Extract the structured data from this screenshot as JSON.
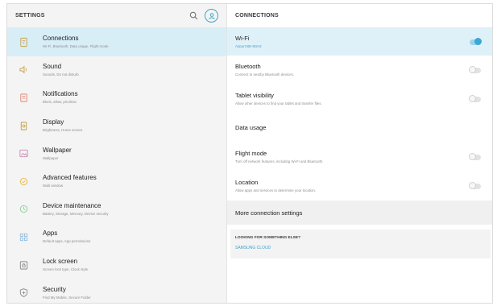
{
  "left_header": {
    "title": "SETTINGS"
  },
  "menu": [
    {
      "title": "Connections",
      "subtitle": "Wi-Fi, Bluetooth, Data usage, Flight mode",
      "icon": "connections-icon",
      "active": true
    },
    {
      "title": "Sound",
      "subtitle": "Sounds, Do not disturb",
      "icon": "speaker-icon"
    },
    {
      "title": "Notifications",
      "subtitle": "Block, allow, prioritise",
      "icon": "notifications-icon"
    },
    {
      "title": "Display",
      "subtitle": "Brightness, Home screen",
      "icon": "display-icon"
    },
    {
      "title": "Wallpaper",
      "subtitle": "Wallpaper",
      "icon": "wallpaper-icon"
    },
    {
      "title": "Advanced features",
      "subtitle": "Multi window",
      "icon": "advanced-features-icon"
    },
    {
      "title": "Device maintenance",
      "subtitle": "Battery, Storage, Memory, Device security",
      "icon": "device-maintenance-icon"
    },
    {
      "title": "Apps",
      "subtitle": "Default apps, App permissions",
      "icon": "apps-icon"
    },
    {
      "title": "Lock screen",
      "subtitle": "Screen lock type, Clock style",
      "icon": "lock-icon"
    },
    {
      "title": "Security",
      "subtitle": "Find My Mobile, Secure Folder",
      "icon": "security-shield-icon"
    }
  ],
  "right_header": {
    "title": "CONNECTIONS"
  },
  "connections": {
    "wifi": {
      "title": "Wi-Fi",
      "subtitle": "Airport BE-5GHz",
      "toggle": "on"
    },
    "bluetooth": {
      "title": "Bluetooth",
      "subtitle": "Connect to nearby Bluetooth devices.",
      "toggle": "off"
    },
    "tablet_visibility": {
      "title": "Tablet visibility",
      "subtitle": "Allow other devices to find your tablet and transfer files.",
      "toggle": "off"
    },
    "data_usage": {
      "title": "Data usage"
    },
    "flight_mode": {
      "title": "Flight mode",
      "subtitle": "Turn off network features, including Wi-Fi and Bluetooth.",
      "toggle": "off"
    },
    "location": {
      "title": "Location",
      "subtitle": "Allow apps and services to determine your location.",
      "toggle": "off"
    },
    "more": {
      "title": "More connection settings"
    },
    "looking": {
      "title": "LOOKING FOR SOMETHING ELSE?",
      "link": "SAMSUNG CLOUD"
    }
  },
  "colors": {
    "accent": "#3aa7d6",
    "selected_bg": "#d8eef7",
    "icon_tint": "#c9a24a"
  }
}
